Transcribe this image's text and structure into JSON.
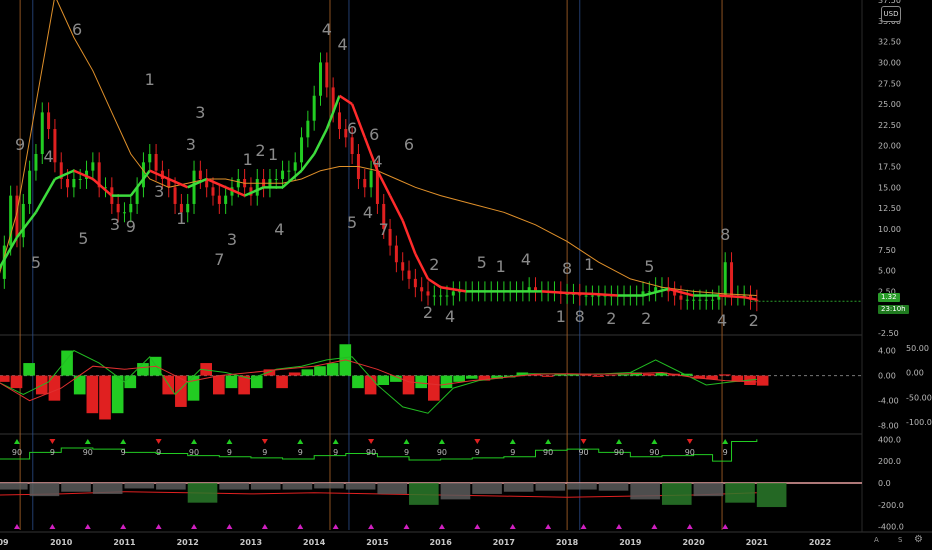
{
  "currency": "USD",
  "scale_buttons": {
    "auto": "A",
    "log": "S"
  },
  "gear_icon": "gear-icon",
  "colors": {
    "up": "#22cc22",
    "down": "#e02020",
    "ema_fast_green": "#3ddc3d",
    "ema_fast_red": "#ff2b2b",
    "ema_slow": "#e0902a",
    "macd_line": "#22bb22",
    "signal_line": "#e03030",
    "price_badge": "#2a9d2a",
    "vline_orange": "#b0662a",
    "vline_blue": "#2b4d8a"
  },
  "badges": {
    "last_price": "1.32",
    "countdown": "23:10h"
  },
  "chart_data": [
    {
      "type": "line",
      "panel": "price",
      "x_ticks": [
        "09",
        "2010",
        "2011",
        "2012",
        "2013",
        "2014",
        "2015",
        "2016",
        "2017",
        "2018",
        "2019",
        "2020",
        "2021",
        "2022"
      ],
      "y_ticks": [
        "-2.50",
        "2.50",
        "5.00",
        "7.50",
        "10.00",
        "12.50",
        "15.00",
        "17.50",
        "20.00",
        "22.50",
        "25.00",
        "27.50",
        "30.00",
        "32.50",
        "35.00",
        "37.50"
      ],
      "ylim": [
        -2.5,
        37.5
      ],
      "xlim": [
        2009.0,
        2022.6
      ],
      "series": [
        {
          "role": "close",
          "x": [
            2009.0,
            2009.1,
            2009.2,
            2009.3,
            2009.4,
            2009.5,
            2009.6,
            2009.7,
            2009.8,
            2009.9,
            2010.0,
            2010.1,
            2010.2,
            2010.3,
            2010.4,
            2010.5,
            2010.6,
            2010.7,
            2010.8,
            2010.9,
            2011.0,
            2011.1,
            2011.2,
            2011.3,
            2011.4,
            2011.5,
            2011.6,
            2011.7,
            2011.8,
            2011.9,
            2012.0,
            2012.1,
            2012.2,
            2012.3,
            2012.4,
            2012.5,
            2012.6,
            2012.7,
            2012.8,
            2012.9,
            2013.0,
            2013.1,
            2013.2,
            2013.3,
            2013.4,
            2013.5,
            2013.6,
            2013.7,
            2013.8,
            2013.9,
            2014.0,
            2014.1,
            2014.2,
            2014.3,
            2014.4,
            2014.5,
            2014.6,
            2014.7,
            2014.8,
            2014.9,
            2015.0,
            2015.1,
            2015.2,
            2015.3,
            2015.4,
            2015.5,
            2015.6,
            2015.7,
            2015.8,
            2015.9,
            2016.0,
            2016.1,
            2016.2,
            2016.3,
            2016.4,
            2016.5,
            2016.6,
            2016.7,
            2016.8,
            2016.9,
            2017.0,
            2017.1,
            2017.2,
            2017.3,
            2017.4,
            2017.5,
            2017.6,
            2017.7,
            2017.8,
            2017.9,
            2018.0,
            2018.1,
            2018.2,
            2018.3,
            2018.4,
            2018.5,
            2018.6,
            2018.7,
            2018.8,
            2018.9,
            2019.0,
            2019.1,
            2019.2,
            2019.3,
            2019.4,
            2019.5,
            2019.6,
            2019.7,
            2019.8,
            2019.9,
            2020.0,
            2020.1,
            2020.2,
            2020.3,
            2020.4,
            2020.5,
            2020.6,
            2020.7,
            2020.8,
            2020.9,
            2021.0
          ],
          "values": [
            4,
            8,
            14,
            9,
            13,
            17,
            19,
            24,
            22,
            18,
            16,
            15,
            16,
            16,
            17,
            18,
            15,
            15,
            13,
            12,
            12,
            13,
            15,
            18,
            19,
            17,
            16,
            15,
            13,
            12,
            13,
            17,
            16,
            15,
            14,
            13,
            14,
            15,
            16,
            15,
            14,
            16,
            15,
            16,
            16,
            17,
            17,
            18,
            21,
            23,
            26,
            30,
            27,
            24,
            22,
            21,
            19,
            16,
            15,
            17,
            13,
            10,
            8,
            6,
            5,
            4,
            3,
            2.5,
            2,
            2,
            2,
            2,
            2.5,
            2.5,
            2.5,
            2.5,
            2.5,
            2.5,
            2.5,
            2.5,
            2.5,
            2.5,
            2.5,
            2.5,
            3,
            2.5,
            2.5,
            2.5,
            2.5,
            2.2,
            2.2,
            2.2,
            2,
            2,
            2,
            2,
            2,
            2,
            2,
            2,
            2,
            2,
            2.5,
            2.5,
            3,
            3,
            2.5,
            2,
            1.5,
            1.5,
            1.5,
            1.5,
            1.5,
            1.5,
            2,
            6,
            2,
            2,
            2,
            1.5,
            1.32
          ]
        },
        {
          "role": "fast average",
          "x": [
            2009.0,
            2009.3,
            2009.6,
            2009.9,
            2010.2,
            2010.5,
            2010.8,
            2011.1,
            2011.4,
            2011.7,
            2012.0,
            2012.3,
            2012.6,
            2012.9,
            2013.2,
            2013.5,
            2013.8,
            2014.0,
            2014.2,
            2014.4,
            2014.6,
            2014.8,
            2015.0,
            2015.2,
            2015.4,
            2015.6,
            2015.8,
            2016.0,
            2016.4,
            2016.8,
            2017.2,
            2017.6,
            2018.0,
            2018.4,
            2018.8,
            2019.2,
            2019.6,
            2020.0,
            2020.4,
            2020.8,
            2021.0
          ],
          "values": [
            5,
            9,
            12,
            16,
            17,
            16,
            14,
            14,
            17,
            16,
            15,
            16,
            15,
            14,
            15,
            15,
            17,
            19,
            22,
            26,
            25,
            21,
            17,
            14,
            11,
            7,
            4,
            3,
            2.5,
            2.5,
            2.5,
            2.5,
            2.3,
            2.2,
            2,
            2,
            2.8,
            2,
            2,
            1.8,
            1.5
          ]
        },
        {
          "role": "slow average",
          "x": [
            2009.0,
            2009.3,
            2009.6,
            2009.9,
            2010.2,
            2010.5,
            2010.8,
            2011.1,
            2011.4,
            2011.7,
            2012.0,
            2012.3,
            2012.6,
            2012.9,
            2013.2,
            2013.5,
            2013.8,
            2014.1,
            2014.4,
            2014.7,
            2015.0,
            2015.3,
            2015.6,
            2016.0,
            2016.5,
            2017.0,
            2017.5,
            2018.0,
            2018.5,
            2019.0,
            2019.5,
            2020.0,
            2020.5,
            2021.0
          ],
          "values": [
            4,
            12,
            25,
            38,
            33,
            29,
            24,
            19,
            16,
            15,
            15.5,
            16,
            16,
            15.5,
            15.5,
            15.5,
            16,
            17,
            17.5,
            17.5,
            17,
            16,
            15,
            14,
            13,
            12,
            10.5,
            8.5,
            6,
            4,
            3,
            2.5,
            2.2,
            2
          ]
        }
      ],
      "annotations": [
        "6",
        "9",
        "4",
        "5",
        "5",
        "3",
        "9",
        "1",
        "3",
        "3",
        "3",
        "1",
        "7",
        "3",
        "1",
        "2",
        "1",
        "4",
        "4",
        "4",
        "6",
        "5",
        "4",
        "4",
        "2",
        "2",
        "4",
        "7",
        "6",
        "6",
        "5",
        "1",
        "1",
        "4",
        "8",
        "8",
        "1",
        "2",
        "8",
        "5",
        "2",
        "4",
        "2"
      ]
    },
    {
      "type": "bar",
      "panel": "oscillator",
      "y_ticks_left": [
        "4.00",
        "0.00",
        "-4.00",
        "-8.00"
      ],
      "y_ticks_right": [
        "50.00",
        "0.00",
        "-50.00",
        "-100.00"
      ],
      "ylim": [
        -9,
        6
      ],
      "dashed_level": "0.00",
      "series": [
        {
          "role": "histogram",
          "x": [
            2009.0,
            2009.2,
            2009.4,
            2009.6,
            2009.8,
            2010.0,
            2010.2,
            2010.4,
            2010.6,
            2010.8,
            2011.0,
            2011.2,
            2011.4,
            2011.6,
            2011.8,
            2012.0,
            2012.2,
            2012.4,
            2012.6,
            2012.8,
            2013.0,
            2013.2,
            2013.4,
            2013.6,
            2013.8,
            2014.0,
            2014.2,
            2014.4,
            2014.6,
            2014.8,
            2015.0,
            2015.2,
            2015.4,
            2015.6,
            2015.8,
            2016.0,
            2016.2,
            2016.4,
            2016.6,
            2016.8,
            2017.0,
            2017.2,
            2017.4,
            2017.6,
            2017.8,
            2018.0,
            2018.2,
            2018.4,
            2018.6,
            2018.8,
            2019.0,
            2019.2,
            2019.4,
            2019.6,
            2019.8,
            2020.0,
            2020.2,
            2020.4,
            2020.6,
            2020.8,
            2021.0
          ],
          "values": [
            -1,
            -2,
            2,
            -3,
            -4,
            4,
            -3,
            -6,
            -7,
            -6,
            -2,
            2,
            3,
            -3,
            -5,
            -4,
            2,
            -3,
            -2,
            -3,
            -2,
            1,
            -2,
            0.5,
            1,
            1.5,
            2,
            5,
            -2,
            -3,
            -1.5,
            -1,
            -3,
            -2,
            -4,
            -2,
            -1,
            -0.5,
            -0.8,
            -0.5,
            -0.3,
            0.5,
            0.2,
            -0.2,
            0.2,
            0.3,
            0.2,
            -0.2,
            0.1,
            0.2,
            0.5,
            0.3,
            0.5,
            0.3,
            0.3,
            -0.5,
            -0.6,
            0.2,
            -1,
            -1.5,
            -1.6
          ]
        },
        {
          "role": "line_a",
          "x": [
            2009.0,
            2009.4,
            2009.8,
            2010.2,
            2010.6,
            2011.0,
            2011.4,
            2011.8,
            2012.2,
            2012.6,
            2013.0,
            2013.4,
            2013.8,
            2014.2,
            2014.6,
            2015.0,
            2015.4,
            2015.8,
            2016.2,
            2016.6,
            2017.0,
            2017.4,
            2017.8,
            2018.2,
            2018.6,
            2019.0,
            2019.4,
            2019.8,
            2020.2,
            2020.6,
            2021.0
          ],
          "values": [
            -1,
            -3,
            -1,
            4,
            2,
            -1,
            3,
            -3,
            1,
            0.5,
            -0.5,
            1,
            1.5,
            2.5,
            3,
            -1.5,
            -5,
            -6,
            -2,
            -0.8,
            -0.3,
            0.3,
            0.3,
            0.2,
            0.3,
            0.5,
            2.5,
            0.5,
            -1.5,
            -1,
            -0.6
          ]
        },
        {
          "role": "line_b",
          "x": [
            2009.0,
            2009.5,
            2010.0,
            2010.5,
            2011.0,
            2011.5,
            2012.0,
            2012.5,
            2013.0,
            2013.5,
            2014.0,
            2014.5,
            2015.0,
            2015.5,
            2016.0,
            2016.5,
            2017.0,
            2017.5,
            2018.0,
            2018.5,
            2019.0,
            2019.5,
            2020.0,
            2020.5,
            2021.0
          ],
          "values": [
            -1,
            -4,
            -2,
            1.5,
            1,
            1.5,
            -1,
            0,
            0.5,
            1,
            1.5,
            2.5,
            1,
            -1,
            -1.5,
            -0.8,
            -0.3,
            0.2,
            0.3,
            0.2,
            0.3,
            0.5,
            -0.3,
            -0.8,
            -1
          ]
        }
      ]
    },
    {
      "type": "line",
      "panel": "signals",
      "y_ticks": [
        "400.0",
        "200.0",
        "0.0",
        "-200.0",
        "-400.0"
      ],
      "ylim": [
        -430,
        430
      ],
      "signal_labels": [
        "90",
        "9",
        "90",
        "9",
        "9",
        "90",
        "9",
        "9",
        "9",
        "9",
        "90",
        "9",
        "90",
        "9",
        "9",
        "90",
        "90",
        "90",
        "90",
        "90",
        "9"
      ],
      "series": [
        {
          "role": "step line",
          "x": [
            2009.0,
            2009.5,
            2010.0,
            2010.5,
            2011.0,
            2011.5,
            2012.0,
            2012.5,
            2013.0,
            2013.5,
            2014.0,
            2014.5,
            2015.0,
            2015.5,
            2016.0,
            2016.5,
            2017.0,
            2017.5,
            2018.0,
            2018.5,
            2019.0,
            2019.5,
            2020.0,
            2020.3,
            2020.6,
            2021.0
          ],
          "values": [
            220,
            280,
            320,
            310,
            280,
            270,
            250,
            240,
            230,
            220,
            250,
            270,
            240,
            210,
            220,
            230,
            240,
            300,
            310,
            280,
            240,
            250,
            260,
            200,
            380,
            400
          ]
        },
        {
          "role": "lower red line",
          "x": [
            2009.0,
            2010.0,
            2011.0,
            2012.0,
            2013.0,
            2014.0,
            2015.0,
            2016.0,
            2017.0,
            2018.0,
            2019.0,
            2020.0,
            2021.0
          ],
          "values": [
            -110,
            -100,
            -80,
            -90,
            -100,
            -90,
            -100,
            -110,
            -120,
            -130,
            -120,
            -110,
            -90
          ]
        },
        {
          "role": "lower histogram",
          "x": [
            2009.0,
            2009.5,
            2010.0,
            2010.5,
            2011.0,
            2011.5,
            2012.0,
            2012.5,
            2013.0,
            2013.5,
            2014.0,
            2014.5,
            2015.0,
            2015.5,
            2016.0,
            2016.5,
            2017.0,
            2017.5,
            2018.0,
            2018.5,
            2019.0,
            2019.5,
            2020.0,
            2020.5,
            2021.0
          ],
          "values": [
            -60,
            -120,
            -80,
            -100,
            -50,
            -60,
            -180,
            -60,
            -60,
            -60,
            -50,
            -60,
            -100,
            -200,
            -150,
            -100,
            -80,
            -70,
            -60,
            -70,
            -150,
            -200,
            -120,
            -180,
            -220
          ]
        }
      ]
    }
  ]
}
